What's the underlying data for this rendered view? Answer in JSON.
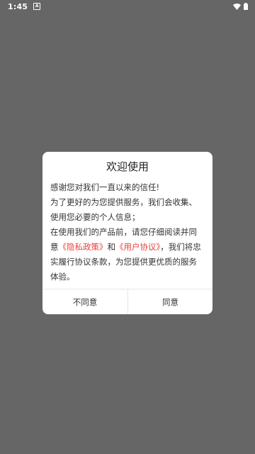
{
  "status_bar": {
    "time": "1:45",
    "notification_icon_letter": "A",
    "icons": [
      "notification-icon",
      "wifi-icon",
      "battery-icon"
    ]
  },
  "dialog": {
    "title": "欢迎使用",
    "line1": "感谢您对我们一直以来的信任!",
    "line2": "为了更好的为您提供服务，我们会收集、使用您必要的个人信息；",
    "line3_prefix": "在使用我们的产品前，请您仔细阅读并同意",
    "privacy_link": "《隐私政策》",
    "and": "和",
    "agreement_link": "《用户协议》",
    "line3_suffix": "，我们将忠实履行协议条款，为您提供更优质的服务体验。",
    "disagree_label": "不同意",
    "agree_label": "同意"
  },
  "colors": {
    "overlay": "#666666",
    "link": "#e8413c",
    "dialog_bg": "#ffffff"
  }
}
